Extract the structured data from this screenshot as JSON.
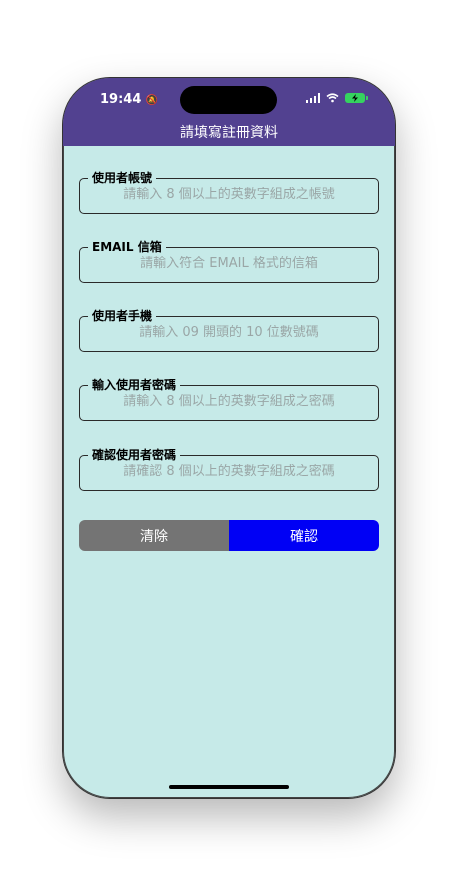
{
  "status_bar": {
    "time": "19:44"
  },
  "header": {
    "title": "請填寫註冊資料"
  },
  "fields": [
    {
      "label": "使用者帳號",
      "placeholder": "請輸入 8 個以上的英數字組成之帳號"
    },
    {
      "label": "EMAIL 信箱",
      "placeholder": "請輸入符合 EMAIL 格式的信箱"
    },
    {
      "label": "使用者手機",
      "placeholder": "請輸入 09 開頭的 10 位數號碼"
    },
    {
      "label": "輸入使用者密碼",
      "placeholder": "請輸入 8 個以上的英數字組成之密碼"
    },
    {
      "label": "確認使用者密碼",
      "placeholder": "請確認 8 個以上的英數字組成之密碼"
    }
  ],
  "buttons": {
    "clear": "清除",
    "confirm": "確認"
  },
  "colors": {
    "header": "#524190",
    "background": "#c6eae8",
    "clear_button": "#747474",
    "confirm_button": "#0000f5",
    "battery": "#35d35f"
  },
  "icons": [
    "bell-slash-icon",
    "signal-icon",
    "wifi-icon",
    "battery-charging-icon"
  ]
}
